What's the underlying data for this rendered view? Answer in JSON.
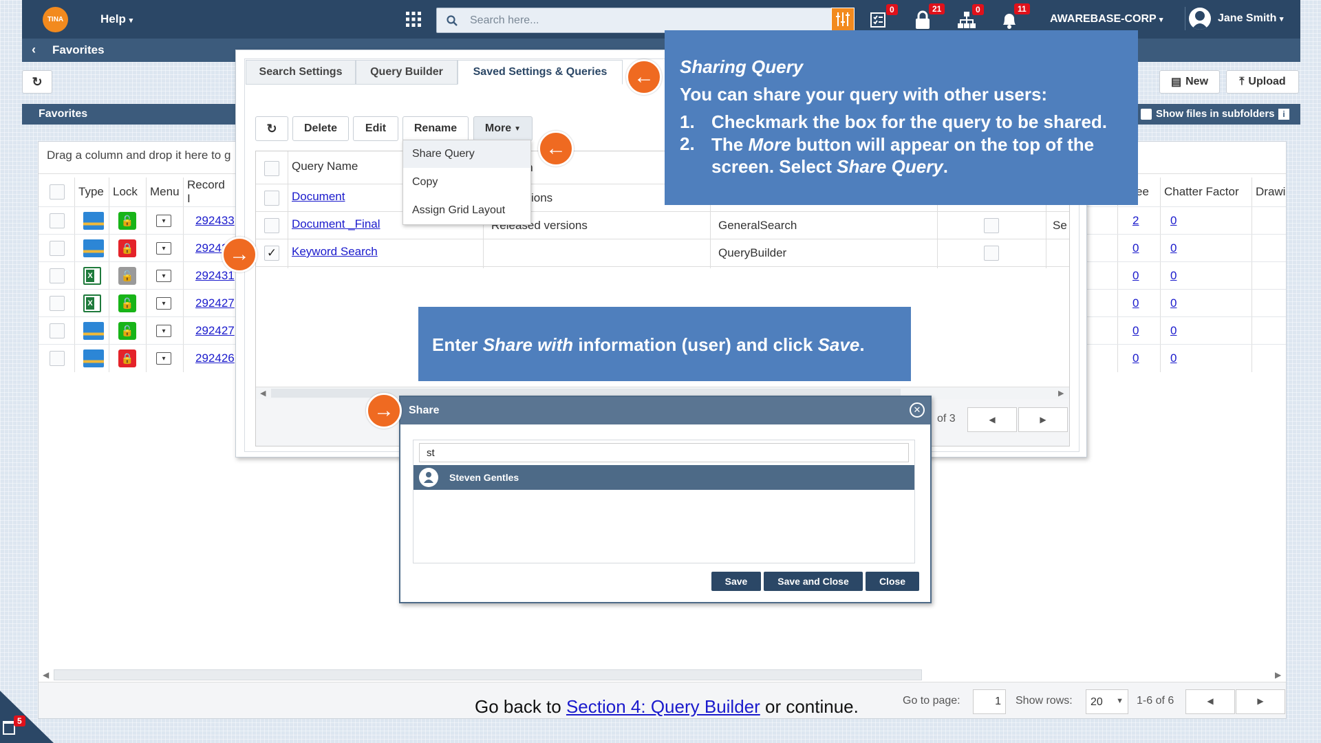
{
  "topbar": {
    "logo": "TINA",
    "help_label": "Help",
    "search_placeholder": "Search here...",
    "badges": {
      "tasks": "0",
      "locks": "21",
      "hierarchy": "0",
      "notifications": "11"
    },
    "org_label": "AWAREBASE-CORP",
    "user_name": "Jane Smith"
  },
  "subbar": {
    "breadcrumb": "Favorites"
  },
  "toolbar": {
    "new_label": "New",
    "upload_label": "Upload",
    "subfolders_label": "Show files in subfolders"
  },
  "favorites": {
    "title": "Favorites",
    "group_hint": "Drag a column and drop it here to g",
    "columns": [
      "Type",
      "Lock",
      "Menu",
      "Record I",
      "ee",
      "Chatter Factor",
      "Drawi"
    ],
    "rows": [
      {
        "record": "292433",
        "lock": "unlocked",
        "type": "image",
        "ee": "2",
        "chatter": "0"
      },
      {
        "record": "29242",
        "lock": "locked",
        "type": "image",
        "ee": "0",
        "chatter": "0"
      },
      {
        "record": "292431",
        "lock": "grey",
        "type": "excel",
        "ee": "0",
        "chatter": "0"
      },
      {
        "record": "292427",
        "lock": "unlocked",
        "type": "excel",
        "ee": "0",
        "chatter": "0"
      },
      {
        "record": "292427",
        "lock": "unlocked",
        "type": "image",
        "ee": "0",
        "chatter": "0"
      },
      {
        "record": "292426",
        "lock": "locked",
        "type": "image",
        "ee": "0",
        "chatter": "0"
      }
    ],
    "pager": {
      "go_to_label": "Go to page:",
      "page": "1",
      "rows_label": "Show rows:",
      "rows": "20",
      "range": "1-6 of 6"
    }
  },
  "panel": {
    "tabs": [
      "Search Settings",
      "Query Builder",
      "Saved Settings & Queries"
    ],
    "buttons": {
      "delete": "Delete",
      "edit": "Edit",
      "rename": "Rename",
      "more": "More"
    },
    "query_header": "Query Name",
    "desc_header_fragment": "ion",
    "queries": [
      {
        "name": "Document",
        "desc": "ions",
        "type": "",
        "checked": false
      },
      {
        "name": "Document _Final",
        "desc": "Released versions",
        "type": "GeneralSearch",
        "extra": "Se",
        "checked": false
      },
      {
        "name": "Keyword Search",
        "desc": "",
        "type": "QueryBuilder",
        "checked": true
      }
    ],
    "pager_text": "of 3"
  },
  "more_menu": [
    "Share Query",
    "Copy",
    "Assign Grid Layout"
  ],
  "callout_top": {
    "title": "Sharing Query",
    "intro": "You can share your query with other users:",
    "step1": "Checkmark the box for the query to be shared.",
    "step2_a": "The ",
    "step2_more": "More",
    "step2_b": " button will appear on the top of the screen. Select ",
    "step2_share": "Share Query",
    "step2_end": "."
  },
  "callout_mid": {
    "a": "Enter ",
    "share_with": "Share with",
    "b": " information (user) and click ",
    "save": "Save",
    "end": "."
  },
  "share_dialog": {
    "title": "Share",
    "input_value": "st",
    "result": "Steven Gentles",
    "save": "Save",
    "save_close": "Save and Close",
    "close": "Close"
  },
  "footer": {
    "prefix": "Go back to ",
    "link": "Section 4: Query Builder",
    "suffix": " or continue."
  },
  "trash_badge": "5",
  "colors": {
    "navy": "#2b4766",
    "accent_orange": "#ef6a21",
    "callout_blue": "#4f7fbd",
    "link": "#1a1acc"
  }
}
